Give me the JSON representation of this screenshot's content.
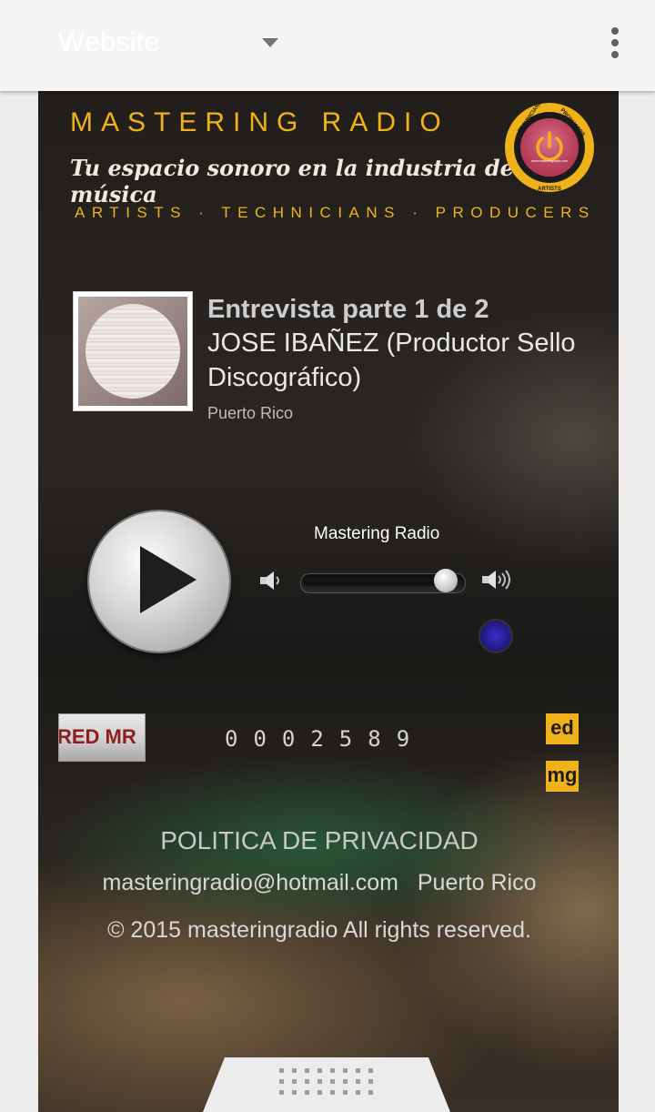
{
  "toolbar": {
    "title": "Website",
    "dropdown_icon": "caret-down-icon",
    "menu_icon": "more-vert-icon"
  },
  "header": {
    "brand": "MASTERING RADIO",
    "tagline": "Tu espacio sonoro en la industria de la música",
    "subtitle": "ARTISTS · TECHNICIANS · PRODUCERS",
    "logo": {
      "ring_top_left": "TECHNICIANS",
      "ring_top_right": "PRODUCERS",
      "ring_bottom": "ARTISTS",
      "center": "www.masteringradio.com",
      "icon": "power-icon",
      "accent": "#f0b21a"
    }
  },
  "now_playing": {
    "part": "Entrevista parte 1 de 2",
    "guest": "JOSE IBAÑEZ (Productor Sello Discográfico)",
    "location": "Puerto Rico"
  },
  "player": {
    "station": "Mastering Radio",
    "play_icon": "play-icon",
    "volume_low_icon": "speaker-low-icon",
    "volume_high_icon": "speaker-high-icon",
    "volume_fraction": 0.95,
    "status_color": "#3b2fc9"
  },
  "badges": {
    "red_mr": "RED MR",
    "counter": "0002589",
    "social_1": "ed",
    "social_2": "mg"
  },
  "footer": {
    "privacy": "POLITICA DE PRIVACIDAD",
    "email": "masteringradio@hotmail.com",
    "location": "Puerto Rico",
    "copyright": "© 2015 masteringradio  All rights reserved."
  },
  "colors": {
    "gold": "#f0b21a",
    "toolbar_bg": "#f5f5f5"
  }
}
